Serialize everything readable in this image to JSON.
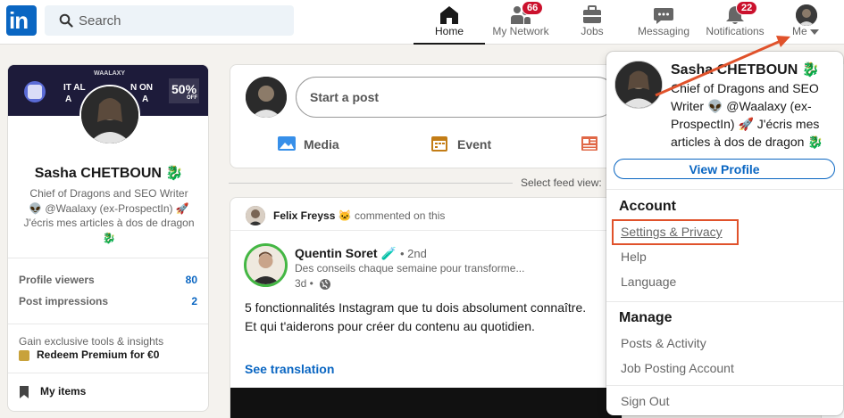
{
  "nav": {
    "logo": "in",
    "search_placeholder": "Search",
    "items": [
      {
        "label": "Home",
        "icon": "home-icon",
        "badge": ""
      },
      {
        "label": "My Network",
        "icon": "network-icon",
        "badge": "66"
      },
      {
        "label": "Jobs",
        "icon": "briefcase-icon",
        "badge": ""
      },
      {
        "label": "Messaging",
        "icon": "message-icon",
        "badge": ""
      },
      {
        "label": "Notifications",
        "icon": "bell-icon",
        "badge": "22"
      },
      {
        "label": "Me",
        "icon": "avatar",
        "badge": ""
      }
    ]
  },
  "profile_card": {
    "banner_line1": "IT AL",
    "banner_line2": "A",
    "banner_line1b": "N ON",
    "banner_line2b": "A",
    "banner_brand": "WAALAXY",
    "banner_promo": "50%",
    "banner_promo_small": "OFF",
    "name": "Sasha CHETBOUN 🐉",
    "headline": "Chief of Dragons and SEO Writer 👽 @Waalaxy (ex-ProspectIn) 🚀 J'écris mes articles à dos de dragon 🐉",
    "stats": [
      {
        "label": "Profile viewers",
        "value": "80"
      },
      {
        "label": "Post impressions",
        "value": "2"
      }
    ],
    "premium_text": "Gain exclusive tools & insights",
    "premium_link": "Redeem Premium for €0",
    "my_items": "My items"
  },
  "composer": {
    "placeholder": "Start a post",
    "actions": [
      {
        "label": "Media",
        "icon": "photo-icon",
        "color": "#378fe9"
      },
      {
        "label": "Event",
        "icon": "calendar-icon",
        "color": "#c37d16"
      },
      {
        "label": "",
        "icon": "article-icon",
        "color": "#e06847"
      }
    ]
  },
  "feed_selector": "Select feed view:",
  "post": {
    "context_actor": "Felix Freyss",
    "context_emoji": "🐱",
    "context_action": "commented on this",
    "author_name": "Quentin Soret 🧪",
    "author_degree": "• 2nd",
    "author_headline": "Des conseils chaque semaine pour transforme...",
    "time": "3d •",
    "body_line1": "5 fonctionnalités Instagram que tu dois absolument connaître.",
    "body_line2": "Et qui t'aiderons pour créer du contenu au quotidien.",
    "see_translation": "See translation"
  },
  "me_menu": {
    "name": "Sasha CHETBOUN 🐉",
    "headline": "Chief of Dragons and SEO Writer 👽 @Waalaxy (ex-ProspectIn) 🚀 J'écris mes articles à dos de dragon 🐉",
    "view_profile": "View Profile",
    "account_header": "Account",
    "account_items": [
      "Settings & Privacy",
      "Help",
      "Language"
    ],
    "manage_header": "Manage",
    "manage_items": [
      "Posts & Activity",
      "Job Posting Account"
    ],
    "sign_out": "Sign Out"
  },
  "colors": {
    "brand": "#0a66c2",
    "highlight": "#e0522b",
    "badge": "#cb112d"
  }
}
